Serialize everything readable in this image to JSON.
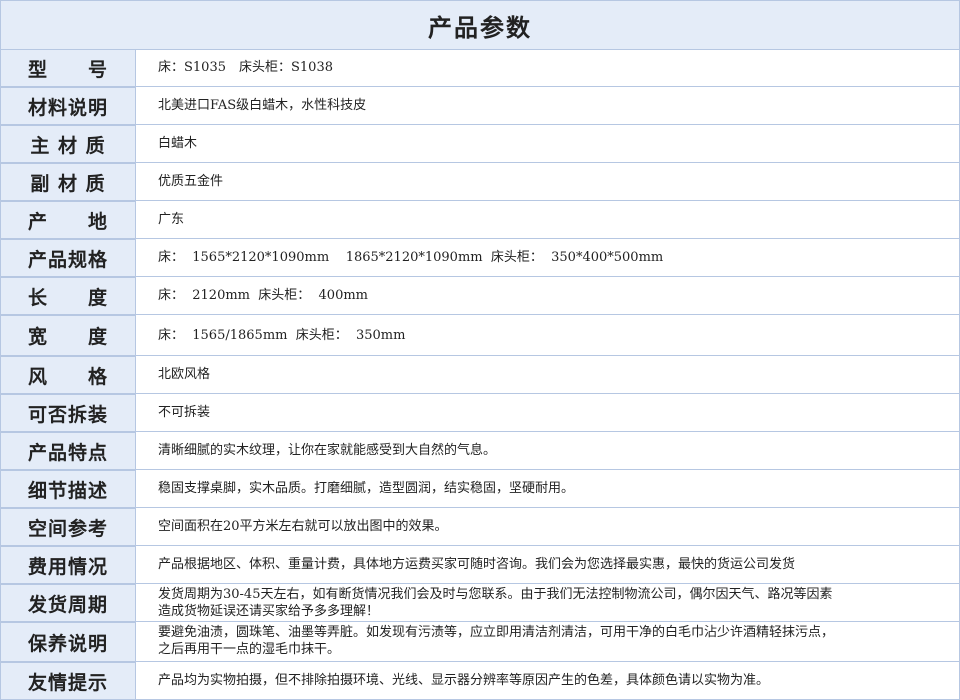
{
  "title": "产品参数",
  "rows": [
    {
      "label": "型　　号",
      "value": "床：S1035　床头柜：S1038"
    },
    {
      "label": "材料说明",
      "value": "北美进口FAS级白蜡木，水性科技皮"
    },
    {
      "label": "主 材 质",
      "value": "白蜡木"
    },
    {
      "label": "副 材 质",
      "value": "优质五金件"
    },
    {
      "label": "产　　地",
      "value": "广东"
    },
    {
      "label": "产品规格",
      "value": "床：  1565*2120*1090mm    1865*2120*1090mm  床头柜：  350*400*500mm"
    },
    {
      "label": "长　　度",
      "value": "床：  2120mm  床头柜：  400mm"
    },
    {
      "label": "宽　　度",
      "value": "床：  1565/1865mm  床头柜：  350mm"
    },
    {
      "label": "风　　格",
      "value": "北欧风格"
    },
    {
      "label": "可否拆装",
      "value": "不可拆装"
    },
    {
      "label": "产品特点",
      "value": "清晰细腻的实木纹理，让你在家就能感受到大自然的气息。"
    },
    {
      "label": "细节描述",
      "value": "稳固支撑桌脚，实木品质。打磨细腻，造型圆润，结实稳固，坚硬耐用。"
    },
    {
      "label": "空间参考",
      "value": "空间面积在20平方米左右就可以放出图中的效果。"
    },
    {
      "label": "费用情况",
      "value": "产品根据地区、体积、重量计费，具体地方运费买家可随时咨询。我们会为您选择最实惠，最快的货运公司发货"
    },
    {
      "label": "发货周期",
      "value": "发货周期为30-45天左右，如有断货情况我们会及时与您联系。由于我们无法控制物流公司，偶尔因天气、路况等因素\n造成货物延误还请买家给予多多理解！"
    },
    {
      "label": "保养说明",
      "value": "要避免油渍，圆珠笔、油墨等弄脏。如发现有污渍等，应立即用清洁剂清洁，可用干净的白毛巾沾少许酒精轻抹污点，\n之后再用干一点的湿毛巾抹干。"
    },
    {
      "label": "友情提示",
      "value": "产品均为实物拍摄，但不排除拍摄环境、光线、显示器分辨率等原因产生的色差，具体颜色请以实物为准。"
    }
  ]
}
